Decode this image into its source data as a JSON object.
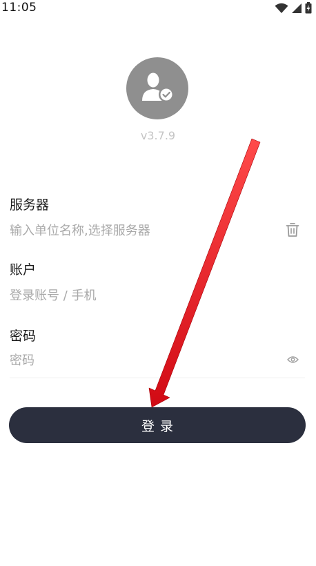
{
  "status_bar": {
    "time": "11:05",
    "icons": [
      "wifi-icon",
      "signal-icon",
      "battery-icon"
    ]
  },
  "app": {
    "avatar_icon": "user-verified-icon",
    "version": "v3.7.9"
  },
  "form": {
    "server": {
      "label": "服务器",
      "placeholder": "输入单位名称,选择服务器",
      "icon": "trash-icon"
    },
    "account": {
      "label": "账户",
      "placeholder": "登录账号 / 手机"
    },
    "password": {
      "label": "密码",
      "placeholder": "密码",
      "icon": "eye-icon"
    },
    "login_label": "登录"
  },
  "colors": {
    "button": "#2b2f3e",
    "avatar": "#8f8f8f",
    "arrow": "#e0121b"
  }
}
